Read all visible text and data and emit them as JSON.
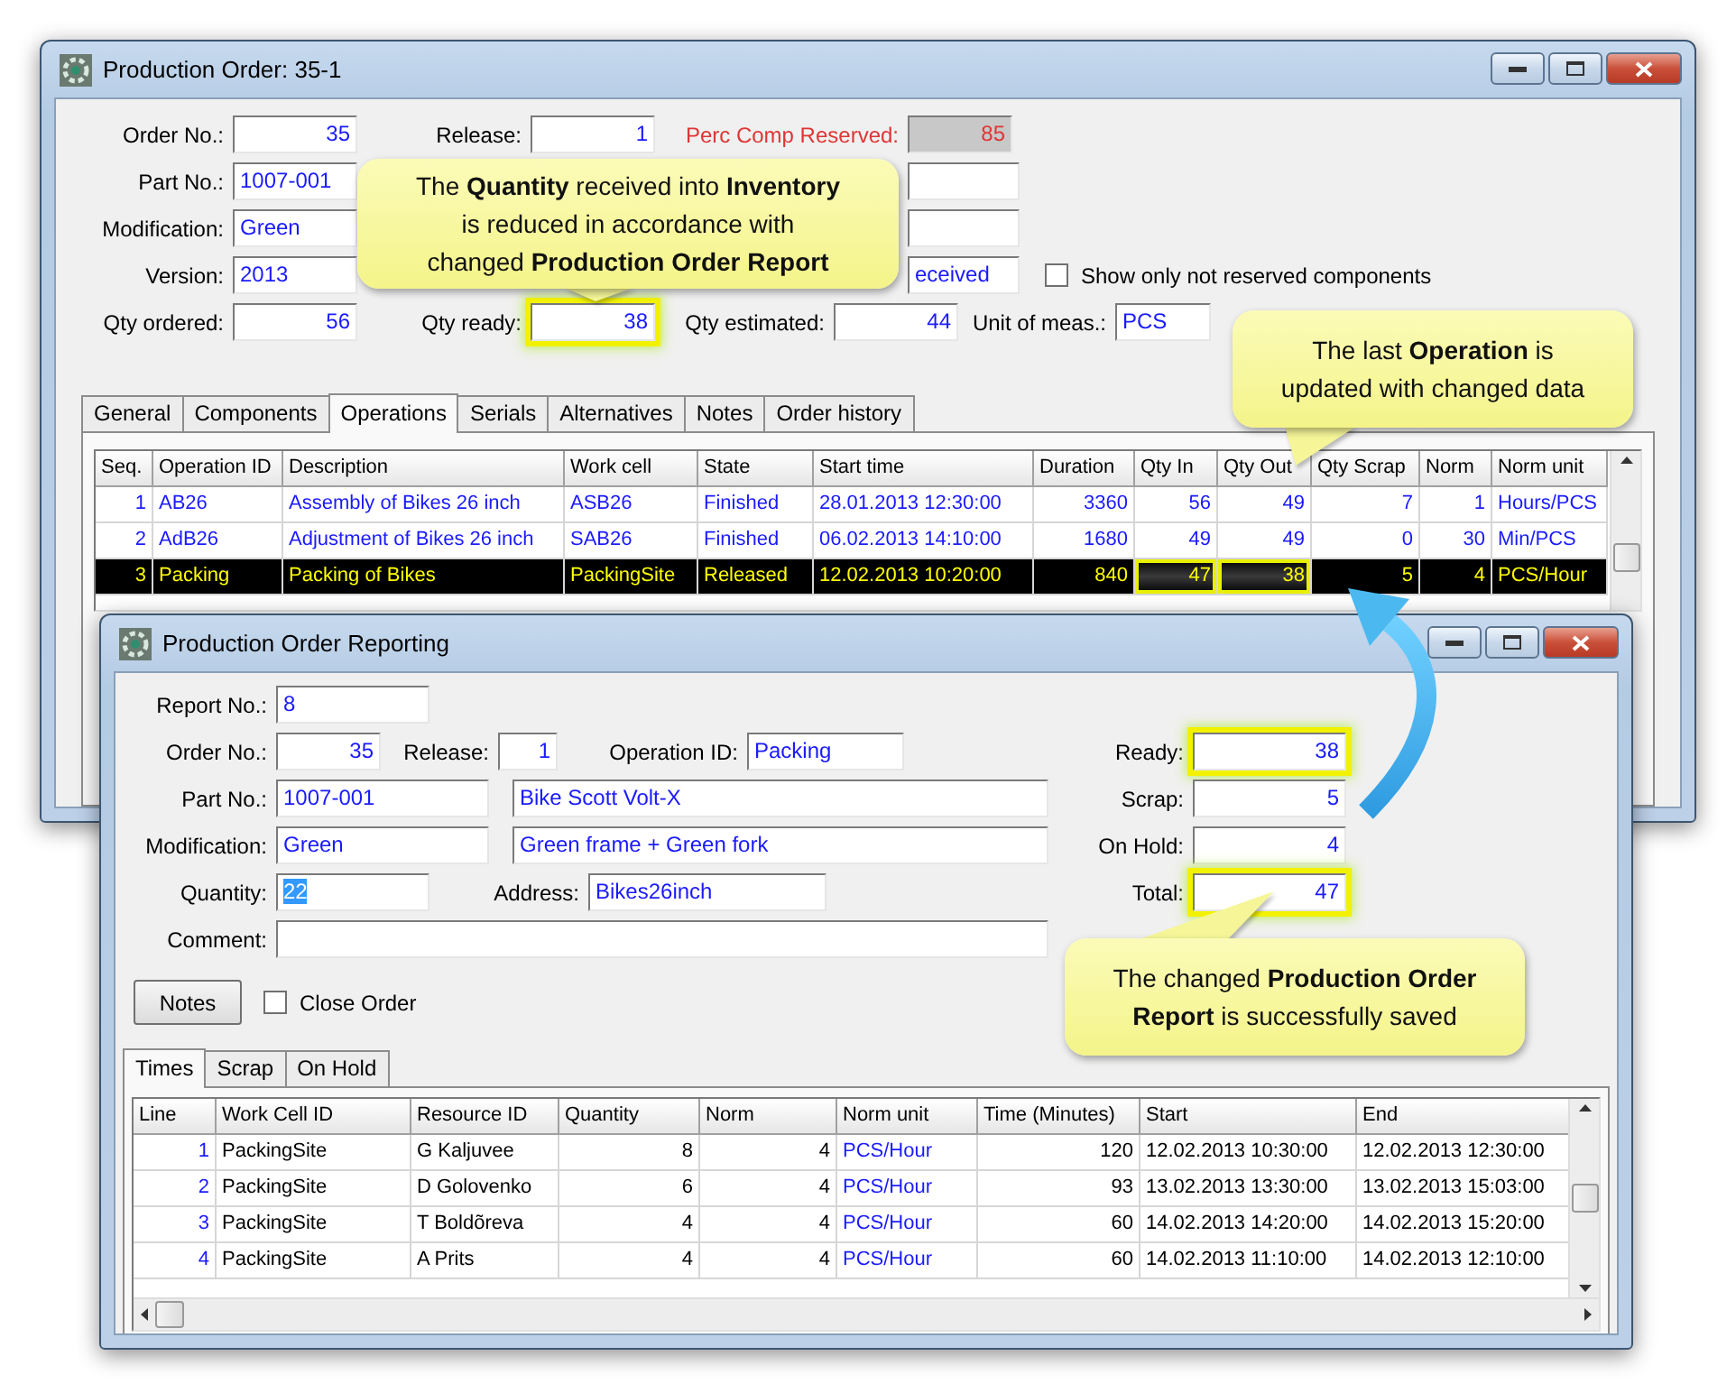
{
  "order_window": {
    "title": "Production Order: 35-1",
    "form_rows": [
      [
        {
          "kind": "number",
          "label": "Order No.:",
          "value": "35"
        },
        {
          "kind": "number",
          "label": "Release:",
          "value": "1"
        },
        {
          "kind": "number",
          "label": "Perc Comp Reserved:",
          "value": "85",
          "readonly": true,
          "alert": true
        }
      ],
      [
        {
          "kind": "text",
          "label": "Part No.:",
          "value": "1007-001"
        },
        {
          "kind": "text"
        }
      ],
      [
        {
          "kind": "text",
          "label": "Modification:",
          "value": "Green"
        },
        {
          "kind": "text"
        }
      ],
      [
        {
          "kind": "text",
          "label": "Version:",
          "value": "2013"
        },
        {
          "kind": "text",
          "value": "eceived"
        },
        {
          "kind": "checkbox",
          "label": "Show only not reserved components",
          "checked": false
        }
      ],
      [
        {
          "kind": "number",
          "label": "Qty ordered:",
          "value": "56"
        },
        {
          "kind": "number",
          "label": "Qty ready:",
          "value": "38",
          "highlighted": true
        },
        {
          "kind": "number",
          "label": "Qty estimated:",
          "value": "44"
        },
        {
          "kind": "text",
          "label": "Unit of meas.:",
          "value": "PCS"
        }
      ]
    ],
    "tabs": [
      {
        "label": "General",
        "selected": false
      },
      {
        "label": "Components",
        "selected": false
      },
      {
        "label": "Operations",
        "selected": true
      },
      {
        "label": "Serials",
        "selected": false
      },
      {
        "label": "Alternatives",
        "selected": false
      },
      {
        "label": "Notes",
        "selected": false
      },
      {
        "label": "Order history",
        "selected": false
      }
    ],
    "table": {
      "columns": [
        {
          "label": "Seq."
        },
        {
          "label": "Operation ID"
        },
        {
          "label": "Description"
        },
        {
          "label": "Work cell"
        },
        {
          "label": "State"
        },
        {
          "label": "Start time"
        },
        {
          "label": "Duration"
        },
        {
          "label": "Qty In"
        },
        {
          "label": "Qty Out"
        },
        {
          "label": "Qty Scrap"
        },
        {
          "label": "Norm"
        },
        {
          "label": "Norm unit"
        }
      ],
      "rows": [
        {
          "selected": false,
          "cells": [
            "1",
            "AB26",
            "Assembly of Bikes 26 inch",
            "ASB26",
            "Finished",
            "28.01.2013 12:30:00",
            "3360",
            "56",
            "49",
            "7",
            "1",
            "Hours/PCS"
          ]
        },
        {
          "selected": false,
          "cells": [
            "2",
            "AdB26",
            "Adjustment of Bikes 26 inch",
            "SAB26",
            "Finished",
            "06.02.2013 14:10:00",
            "1680",
            "49",
            "49",
            "0",
            "30",
            "Min/PCS"
          ]
        },
        {
          "selected": true,
          "cells": [
            "3",
            "Packing",
            "Packing of Bikes",
            "PackingSite",
            "Released",
            "12.02.2013 10:20:00",
            "840",
            {
              "text": "47",
              "highlighted": true
            },
            {
              "text": "38",
              "highlighted": true
            },
            "5",
            "4",
            "PCS/Hour"
          ]
        }
      ]
    }
  },
  "report_window": {
    "title": "Production Order Reporting",
    "form_rows": [
      [
        {
          "kind": "text",
          "label": "Report No.:",
          "value": "8"
        }
      ],
      [
        {
          "kind": "number",
          "label": "Order No.:",
          "value": "35"
        },
        {
          "kind": "number",
          "label": "Release:",
          "value": "1"
        },
        {
          "kind": "text",
          "label": "Operation ID:",
          "value": "Packing"
        }
      ],
      [
        {
          "kind": "text",
          "label": "Part No.:",
          "value": "1007-001"
        },
        {
          "kind": "text",
          "value": "Bike Scott Volt-X"
        }
      ],
      [
        {
          "kind": "text",
          "label": "Modification:",
          "value": "Green"
        },
        {
          "kind": "text",
          "value": "Green frame + Green fork"
        }
      ],
      [
        {
          "kind": "text",
          "label": "Quantity:",
          "value": "22",
          "text_selected": true
        },
        {
          "kind": "text",
          "label": "Address:",
          "value": "Bikes26inch"
        }
      ],
      [
        {
          "kind": "text",
          "label": "Comment:"
        }
      ]
    ],
    "totals": [
      {
        "kind": "number",
        "label": "Ready:",
        "value": "38",
        "highlighted": true
      },
      {
        "kind": "number",
        "label": "Scrap:",
        "value": "5"
      },
      {
        "kind": "number",
        "label": "On Hold:",
        "value": "4"
      },
      {
        "kind": "number",
        "label": "Total:",
        "value": "47",
        "highlighted": true
      }
    ],
    "notes_button": "Notes",
    "close_order": {
      "label": "Close Order",
      "checked": false
    },
    "tabs": [
      {
        "label": "Times",
        "selected": true
      },
      {
        "label": "Scrap",
        "selected": false
      },
      {
        "label": "On Hold",
        "selected": false
      }
    ],
    "table": {
      "columns": [
        {
          "label": "Line"
        },
        {
          "label": "Work Cell ID"
        },
        {
          "label": "Resource ID"
        },
        {
          "label": "Quantity"
        },
        {
          "label": "Norm"
        },
        {
          "label": "Norm unit"
        },
        {
          "label": "Time (Minutes)"
        },
        {
          "label": "Start"
        },
        {
          "label": "End"
        }
      ],
      "rows": [
        {
          "selected": false,
          "cells": [
            "1",
            "PackingSite",
            "G Kaljuvee",
            "8",
            "4",
            "PCS/Hour",
            "120",
            "12.02.2013 10:30:00",
            "12.02.2013 12:30:00"
          ]
        },
        {
          "selected": false,
          "cells": [
            "2",
            "PackingSite",
            "D Golovenko",
            "6",
            "4",
            "PCS/Hour",
            "93",
            "13.02.2013 13:30:00",
            "13.02.2013 15:03:00"
          ]
        },
        {
          "selected": false,
          "cells": [
            "3",
            "PackingSite",
            "T Boldõreva",
            "4",
            "4",
            "PCS/Hour",
            "60",
            "14.02.2013 14:20:00",
            "14.02.2013 15:20:00"
          ]
        },
        {
          "selected": false,
          "cells": [
            "4",
            "PackingSite",
            "A Prits",
            "4",
            "4",
            "PCS/Hour",
            "60",
            "14.02.2013 11:10:00",
            "14.02.2013 12:10:00"
          ]
        }
      ]
    }
  },
  "callouts": [
    {
      "text": "The **Quantity** received into **Inventory**\nis reduced in accordance with\nchanged **Production Order Report**"
    },
    {
      "text": "The last **Operation** is\nupdated with changed data"
    },
    {
      "text": "The changed **Production Order**\n**Report** is successfully saved"
    }
  ]
}
